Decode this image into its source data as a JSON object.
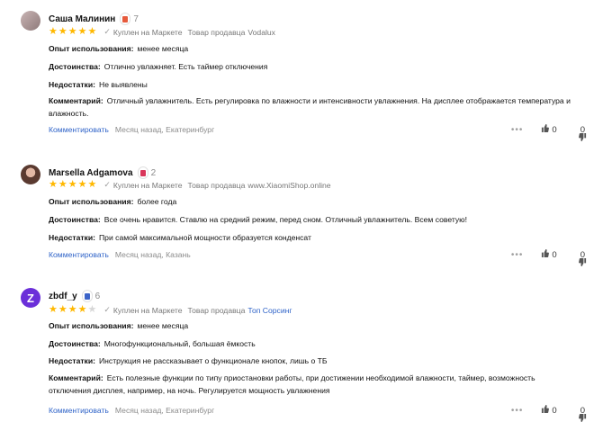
{
  "reviews": [
    {
      "author": "Саша Малинин",
      "badge_color": "#e65a3c",
      "count": "7",
      "rating": 5,
      "verified_label": "Куплен на Маркете",
      "seller_label": "Товар продавца",
      "seller": "Vodalux",
      "seller_is_link": false,
      "fields": [
        {
          "label": "Опыт использования:",
          "value": "менее месяца"
        },
        {
          "label": "Достоинства:",
          "value": "Отлично увлажняет. Есть таймер отключения"
        },
        {
          "label": "Недостатки:",
          "value": "Не выявлены"
        },
        {
          "label": "Комментарий:",
          "value": "Отличный увлажнитель. Есть регулировка по влажности и интенсивности увлажнения. На дисплее отображается температура и влажность."
        }
      ],
      "comment_link": "Комментировать",
      "meta": "Месяц назад, Екатеринбург",
      "likes": "0",
      "dislikes": "0"
    },
    {
      "author": "Marsella Adgamova",
      "badge_color": "#d9365a",
      "count": "2",
      "rating": 5,
      "verified_label": "Куплен на Маркете",
      "seller_label": "Товар продавца",
      "seller": "www.XiaomiShop.online",
      "seller_is_link": false,
      "fields": [
        {
          "label": "Опыт использования:",
          "value": "более года"
        },
        {
          "label": "Достоинства:",
          "value": "Все очень нравится. Ставлю на средний режим, перед сном. Отличный увлажнитель. Всем советую!"
        },
        {
          "label": "Недостатки:",
          "value": "При самой максимальной мощности образуется конденсат"
        }
      ],
      "comment_link": "Комментировать",
      "meta": "Месяц назад, Казань",
      "likes": "0",
      "dislikes": "0"
    },
    {
      "author": "zbdf_y",
      "badge_color": "#3c64c8",
      "count": "6",
      "rating": 4,
      "verified_label": "Куплен на Маркете",
      "seller_label": "Товар продавца",
      "seller": "Топ Сорсинг",
      "seller_is_link": true,
      "fields": [
        {
          "label": "Опыт использования:",
          "value": "менее месяца"
        },
        {
          "label": "Достоинства:",
          "value": "Многофункциональный, большая ёмкость"
        },
        {
          "label": "Недостатки:",
          "value": "Инструкция не рассказывает о функционале кнопок, лишь о ТБ"
        },
        {
          "label": "Комментарий:",
          "value": "Есть полезные функции по типу приостановки работы, при достижении необходимой влажности, таймер, возможность отключения дисплея, например, на ночь. Регулируется мощность увлажнения"
        }
      ],
      "comment_link": "Комментировать",
      "meta": "Месяц назад, Екатеринбург",
      "likes": "0",
      "dislikes": "0"
    }
  ]
}
